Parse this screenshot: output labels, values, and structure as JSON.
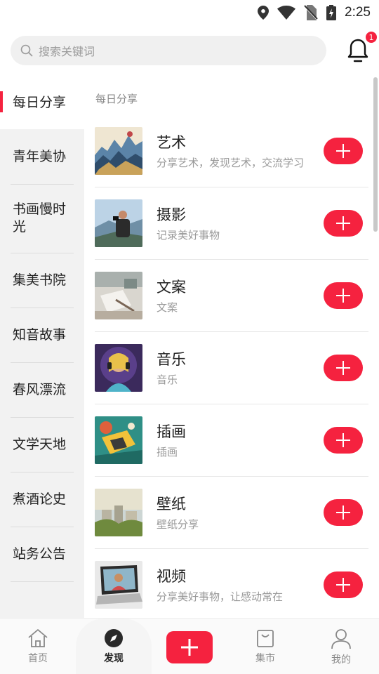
{
  "status_bar": {
    "time": "2:25",
    "icons": [
      "location-icon",
      "wifi-icon",
      "no-sim-icon",
      "battery-charging-icon"
    ]
  },
  "header": {
    "search_placeholder": "搜索关键词",
    "notification_badge": "1"
  },
  "sidebar": {
    "items": [
      {
        "label": "每日分享",
        "active": true
      },
      {
        "label": "青年美协"
      },
      {
        "label": "书画慢时光"
      },
      {
        "label": "集美书院"
      },
      {
        "label": "知音故事"
      },
      {
        "label": "春风漂流"
      },
      {
        "label": "文学天地"
      },
      {
        "label": "煮酒论史"
      },
      {
        "label": "站务公告"
      }
    ]
  },
  "content": {
    "section_title": "每日分享",
    "cards": [
      {
        "name": "艺术",
        "desc": "分享艺术，发现艺术，交流学习",
        "thumb": "landscape-painting"
      },
      {
        "name": "摄影",
        "desc": "记录美好事物",
        "thumb": "photographer"
      },
      {
        "name": "文案",
        "desc": "文案",
        "thumb": "desk-writing"
      },
      {
        "name": "音乐",
        "desc": "音乐",
        "thumb": "girl-headphones"
      },
      {
        "name": "插画",
        "desc": "插画",
        "thumb": "illustration"
      },
      {
        "name": "壁纸",
        "desc": "壁纸分享",
        "thumb": "city-wallpaper"
      },
      {
        "name": "视频",
        "desc": "分享美好事物，让感动常在",
        "thumb": "laptop-video"
      }
    ]
  },
  "tabbar": {
    "tabs": [
      {
        "label": "首页",
        "icon": "home-icon"
      },
      {
        "label": "发现",
        "icon": "compass-icon",
        "active": true
      },
      {
        "label": "",
        "icon": "plus-icon"
      },
      {
        "label": "集市",
        "icon": "shopping-bag-icon"
      },
      {
        "label": "我的",
        "icon": "user-icon"
      }
    ]
  },
  "colors": {
    "accent": "#f5223f"
  }
}
